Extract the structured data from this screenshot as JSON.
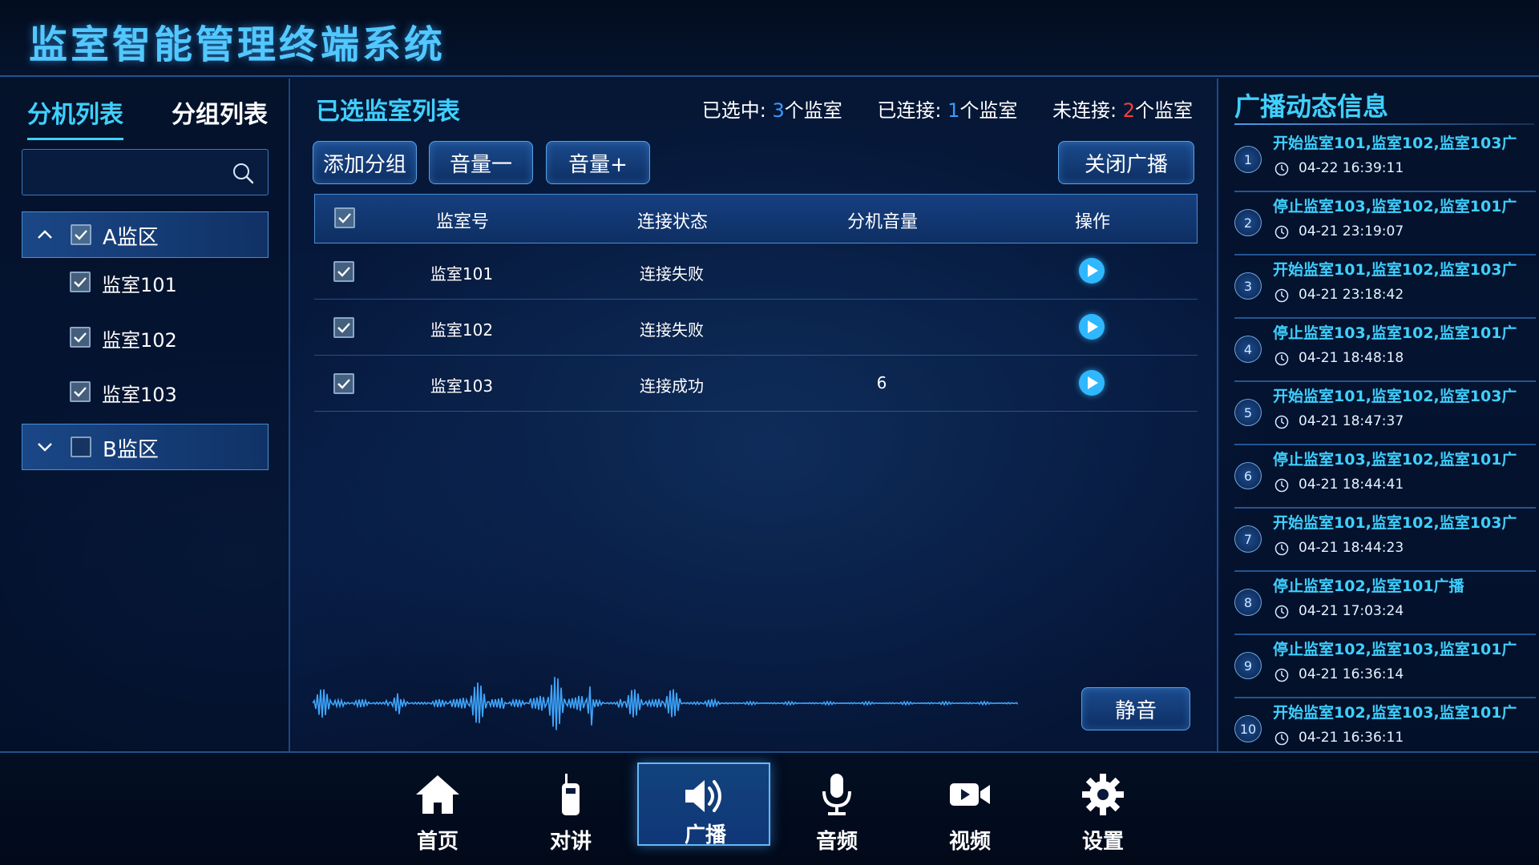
{
  "app": {
    "title": "监室智能管理终端系统"
  },
  "left": {
    "tabs": [
      "分机列表",
      "分组列表"
    ],
    "search": {
      "value": "",
      "placeholder": ""
    },
    "groups": [
      {
        "label": "A监区",
        "expanded": true,
        "checked": true,
        "items": [
          {
            "label": "监室101",
            "checked": true
          },
          {
            "label": "监室102",
            "checked": true
          },
          {
            "label": "监室103",
            "checked": true
          }
        ]
      },
      {
        "label": "B监区",
        "expanded": false,
        "checked": false,
        "items": []
      }
    ]
  },
  "center": {
    "title": "已选监室列表",
    "stats": {
      "selected_prefix": "已选中: ",
      "selected_count": "3",
      "selected_suffix": "个监室",
      "connected_prefix": "已连接: ",
      "connected_count": "1",
      "connected_suffix": "个监室",
      "disconnected_prefix": "未连接: ",
      "disconnected_count": "2",
      "disconnected_suffix": "个监室"
    },
    "buttons": {
      "add_group": "添加分组",
      "volume_down": "音量一",
      "volume_up": "音量+",
      "close_broadcast": "关闭广播",
      "mute": "静音"
    },
    "table": {
      "headers": [
        "监室号",
        "连接状态",
        "分机音量",
        "操作"
      ],
      "rows": [
        {
          "room": "监室101",
          "status": "连接失败",
          "volume": ""
        },
        {
          "room": "监室102",
          "status": "连接失败",
          "volume": ""
        },
        {
          "room": "监室103",
          "status": "连接成功",
          "volume": "6"
        }
      ]
    }
  },
  "right": {
    "title": "广播动态信息",
    "events": [
      {
        "no": "1",
        "text": "开始监室101,监室102,监室103广",
        "time": "04-22 16:39:11"
      },
      {
        "no": "2",
        "text": "停止监室103,监室102,监室101广",
        "time": "04-21 23:19:07"
      },
      {
        "no": "3",
        "text": "开始监室101,监室102,监室103广",
        "time": "04-21 23:18:42"
      },
      {
        "no": "4",
        "text": "停止监室103,监室102,监室101广",
        "time": "04-21 18:48:18"
      },
      {
        "no": "5",
        "text": "开始监室101,监室102,监室103广",
        "time": "04-21 18:47:37"
      },
      {
        "no": "6",
        "text": "停止监室103,监室102,监室101广",
        "time": "04-21 18:44:41"
      },
      {
        "no": "7",
        "text": "开始监室101,监室102,监室103广",
        "time": "04-21 18:44:23"
      },
      {
        "no": "8",
        "text": "停止监室102,监室101广播",
        "time": "04-21 17:03:24"
      },
      {
        "no": "9",
        "text": "停止监室102,监室103,监室101广",
        "time": "04-21 16:36:14"
      },
      {
        "no": "10",
        "text": "开始监室102,监室103,监室101广",
        "time": "04-21 16:36:11"
      }
    ]
  },
  "nav": {
    "items": [
      {
        "label": "首页",
        "icon": "home-icon"
      },
      {
        "label": "对讲",
        "icon": "walkie-talkie-icon"
      },
      {
        "label": "广播",
        "icon": "speaker-icon",
        "active": true
      },
      {
        "label": "音频",
        "icon": "microphone-icon"
      },
      {
        "label": "视频",
        "icon": "video-camera-icon"
      },
      {
        "label": "设置",
        "icon": "gear-icon"
      }
    ]
  },
  "colors": {
    "accent": "#3fd0ff",
    "connected_count": "#3a9cff",
    "disconnected_count": "#ff3b3b",
    "background": "#06183a"
  }
}
